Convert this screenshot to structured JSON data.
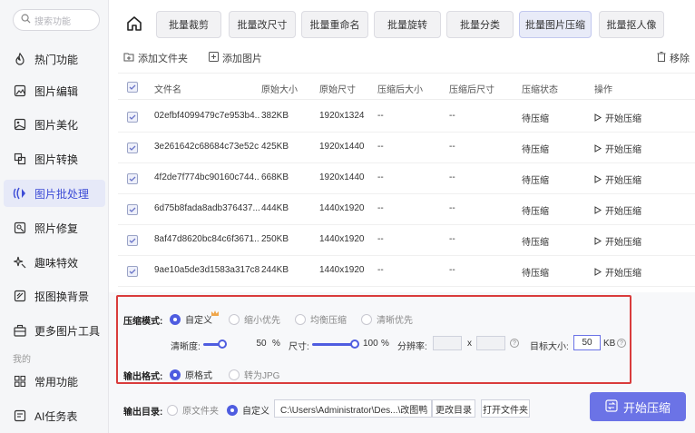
{
  "sidebar": {
    "search_placeholder": "搜索功能",
    "items": [
      {
        "label": "热门功能",
        "icon": "fire-icon"
      },
      {
        "label": "图片编辑",
        "icon": "image-edit-icon"
      },
      {
        "label": "图片美化",
        "icon": "image-beautify-icon"
      },
      {
        "label": "图片转换",
        "icon": "convert-icon"
      },
      {
        "label": "图片批处理",
        "icon": "batch-icon"
      },
      {
        "label": "照片修复",
        "icon": "repair-icon"
      },
      {
        "label": "趣味特效",
        "icon": "sparkle-icon"
      },
      {
        "label": "抠图换背景",
        "icon": "cutout-icon"
      },
      {
        "label": "更多图片工具",
        "icon": "toolbox-icon"
      }
    ],
    "section_mine": "我的",
    "mine_items": [
      {
        "label": "常用功能",
        "icon": "grid-icon"
      },
      {
        "label": "AI任务表",
        "icon": "list-icon"
      }
    ]
  },
  "toolbar": {
    "tabs": [
      "批量裁剪",
      "批量改尺寸",
      "批量重命名",
      "批量旋转",
      "批量分类",
      "批量图片压缩",
      "批量抠人像"
    ]
  },
  "subbar": {
    "add_folder": "添加文件夹",
    "add_image": "添加图片",
    "remove": "移除"
  },
  "table": {
    "headers": [
      "文件名",
      "原始大小",
      "原始尺寸",
      "压缩后大小",
      "压缩后尺寸",
      "压缩状态",
      "操作"
    ],
    "rows": [
      {
        "name": "02efbf4099479c7e953b4...",
        "size": "382KB",
        "dims": "1920x1324",
        "csize": "--",
        "cdims": "--",
        "status": "待压缩",
        "action": "开始压缩"
      },
      {
        "name": "3e261642c68684c73e52c...",
        "size": "425KB",
        "dims": "1920x1440",
        "csize": "--",
        "cdims": "--",
        "status": "待压缩",
        "action": "开始压缩"
      },
      {
        "name": "4f2de7f774bc90160c744...",
        "size": "668KB",
        "dims": "1920x1440",
        "csize": "--",
        "cdims": "--",
        "status": "待压缩",
        "action": "开始压缩"
      },
      {
        "name": "6d75b8fada8adb376437...",
        "size": "444KB",
        "dims": "1440x1920",
        "csize": "--",
        "cdims": "--",
        "status": "待压缩",
        "action": "开始压缩"
      },
      {
        "name": "8af47d8620bc84c6f3671...",
        "size": "250KB",
        "dims": "1440x1920",
        "csize": "--",
        "cdims": "--",
        "status": "待压缩",
        "action": "开始压缩"
      },
      {
        "name": "9ae10a5de3d1583a317c8...",
        "size": "244KB",
        "dims": "1440x1920",
        "csize": "--",
        "cdims": "--",
        "status": "待压缩",
        "action": "开始压缩"
      }
    ]
  },
  "settings": {
    "mode_label": "压缩模式:",
    "modes": [
      "自定义",
      "缩小优先",
      "均衡压缩",
      "清晰优先"
    ],
    "clarity_label": "清晰度:",
    "clarity_value": "50",
    "clarity_unit": "%",
    "size_label": "尺寸:",
    "size_value": "100",
    "size_unit": "%",
    "resolution_label": "分辨率:",
    "x_label": "x",
    "target_label": "目标大小:",
    "target_value": "50",
    "target_unit": "KB",
    "format_label": "输出格式:",
    "formats": [
      "原格式",
      "转为JPG"
    ]
  },
  "output": {
    "dir_label": "输出目录:",
    "options": [
      "原文件夹",
      "自定义"
    ],
    "path": "C:\\Users\\Administrator\\Des...\\改图鸭",
    "change_dir": "更改目录",
    "open_folder": "打开文件夹",
    "start": "开始压缩"
  },
  "colors": {
    "accent": "#4f5de0",
    "highlight_border": "#d93c3c",
    "start_button": "#6b73e6"
  }
}
